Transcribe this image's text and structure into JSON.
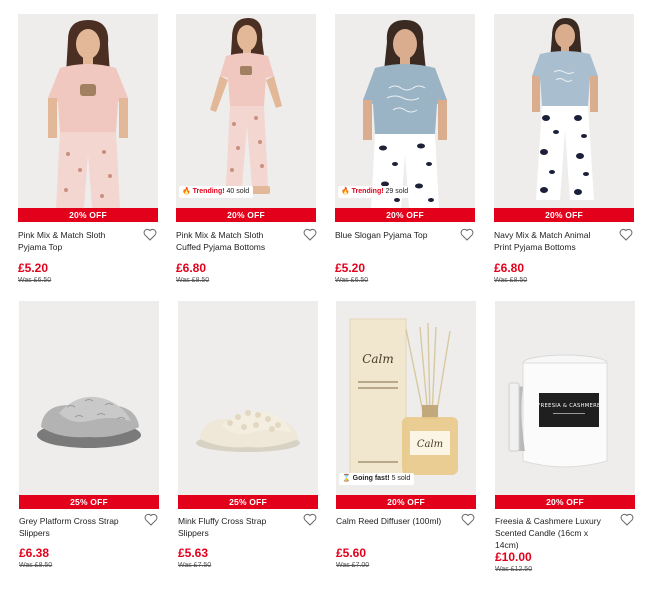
{
  "colors": {
    "accent": "#e3001b",
    "background": "#ffffff",
    "image_bg": "#eeedeb"
  },
  "products": [
    {
      "name": "Pink Mix & Match Sloth Pyjama Top",
      "discount": "20% OFF",
      "price": "£5.20",
      "was": "Was £6.50",
      "badge": null,
      "image": "woman-pink-sloth-top"
    },
    {
      "name": "Pink Mix & Match Sloth Cuffed Pyjama Bottoms",
      "discount": "20% OFF",
      "price": "£6.80",
      "was": "Was £8.50",
      "badge": {
        "icon": "fire-icon",
        "strong": "Trending!",
        "text": "40 sold"
      },
      "image": "woman-pink-sloth-bottoms"
    },
    {
      "name": "Blue Slogan Pyjama Top",
      "discount": "20% OFF",
      "price": "£5.20",
      "was": "Was £6.50",
      "badge": {
        "icon": "fire-icon",
        "strong": "Trending!",
        "text": "29 sold"
      },
      "image": "woman-blue-slogan-top"
    },
    {
      "name": "Navy Mix & Match Animal Print Pyjama Bottoms",
      "discount": "20% OFF",
      "price": "£6.80",
      "was": "Was £8.50",
      "badge": null,
      "image": "woman-navy-animal-bottoms"
    },
    {
      "name": "Grey Platform Cross Strap Slippers",
      "discount": "25% OFF",
      "price": "£6.38",
      "was": "Was £8.50",
      "badge": null,
      "image": "grey-fluffy-slipper"
    },
    {
      "name": "Mink Fluffy Cross Strap Slippers",
      "discount": "25% OFF",
      "price": "£5.63",
      "was": "Was £7.50",
      "badge": null,
      "image": "mink-fluffy-slipper"
    },
    {
      "name": "Calm Reed Diffuser (100ml)",
      "discount": "20% OFF",
      "price": "£5.60",
      "was": "Was £7.00",
      "badge": {
        "icon": "hourglass-icon",
        "strong": "Going fast!",
        "text": "5 sold"
      },
      "image": "reed-diffuser",
      "product_label": "Calm"
    },
    {
      "name": "Freesia & Cashmere Luxury Scented Candle (16cm x 14cm)",
      "discount": "20% OFF",
      "price": "£10.00",
      "was": "Was £12.50",
      "badge": null,
      "image": "white-candle",
      "product_label": "FREESIA & CASHMERE"
    }
  ]
}
